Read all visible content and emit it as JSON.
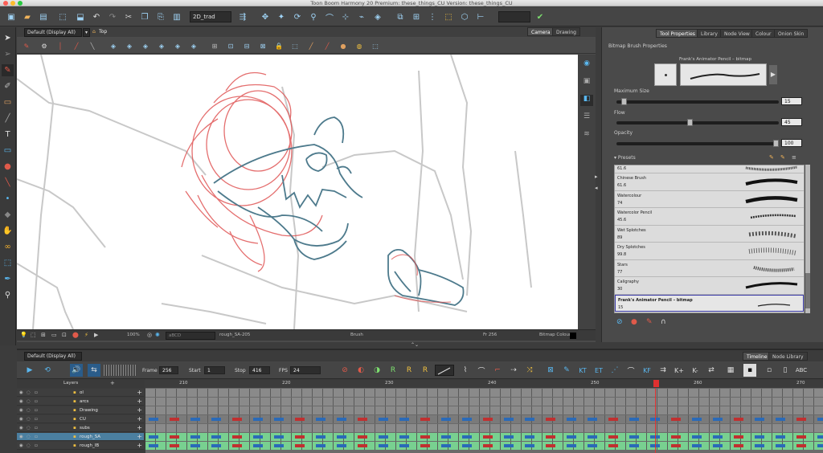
{
  "window": {
    "title": "Toon Boom Harmony 20 Premium: these_things_CU Version: these_things_CU",
    "traffic_lights": [
      "#fc5f57",
      "#fdbc2e",
      "#28c840"
    ]
  },
  "toolbar": {
    "palette_field": "2D_trad"
  },
  "camera": {
    "workspace_dropdown": "Default (Display All)",
    "breadcrumb": "Top",
    "tabs": [
      {
        "label": "Camera",
        "active": true
      },
      {
        "label": "Drawing",
        "active": false
      }
    ],
    "status": {
      "zoom": "100%",
      "color_name": "aBCD",
      "drawing_name": "rough_SA-205",
      "tool": "Brush",
      "frame": "Fr 256",
      "mode": "Bitmap Colour"
    }
  },
  "right_panel": {
    "tabs": [
      {
        "label": "Tool Properties",
        "active": true
      },
      {
        "label": "Library",
        "active": false
      },
      {
        "label": "Node View",
        "active": false
      },
      {
        "label": "Colour",
        "active": false
      },
      {
        "label": "Onion Skin",
        "active": false
      }
    ],
    "section_title": "Bitmap Brush Properties",
    "brush_name": "Frank's Animator Pencil – bitmap",
    "maximum_size_label": "Maximum Size",
    "maximum_size": "15",
    "maximum_size_fraction": 0.03,
    "flow_label": "Flow",
    "flow": "45",
    "flow_fraction": 0.45,
    "opacity_label": "Opacity",
    "opacity": "100",
    "opacity_fraction": 1.0,
    "presets_label": "Presets",
    "presets": [
      {
        "name": "",
        "size": "61.6"
      },
      {
        "name": "Chinese Brush",
        "size": "61.6"
      },
      {
        "name": "Watercolour",
        "size": "74"
      },
      {
        "name": "Watercolor Pencil",
        "size": "45.6"
      },
      {
        "name": "Wet Splotches",
        "size": "89"
      },
      {
        "name": "Dry Splotches",
        "size": "99.8"
      },
      {
        "name": "Stars",
        "size": "77"
      },
      {
        "name": "Caligraphy",
        "size": "30"
      },
      {
        "name": "Frank's Animator Pencil – bitmap",
        "size": "15",
        "selected": true
      }
    ]
  },
  "timeline": {
    "workspace_dropdown": "Default (Display All)",
    "tabs": [
      {
        "label": "Timeline",
        "active": true
      },
      {
        "label": "Node Library",
        "active": false
      }
    ],
    "frame_label": "Frame",
    "frame": "256",
    "start_label": "Start",
    "start": "1",
    "stop_label": "Stop",
    "stop": "416",
    "fps_label": "FPS",
    "fps": "24",
    "layers_header": "Layers",
    "layers": [
      {
        "name": "ol",
        "selected": false
      },
      {
        "name": "arcs",
        "selected": false
      },
      {
        "name": "Drawing",
        "selected": false
      },
      {
        "name": "CU",
        "selected": false
      },
      {
        "name": "subs",
        "selected": false
      },
      {
        "name": "rough_SA",
        "selected": true
      },
      {
        "name": "rough_IB",
        "selected": false
      }
    ],
    "ruler_ticks": [
      "210",
      "220",
      "230",
      "240",
      "250",
      "260",
      "270"
    ]
  }
}
